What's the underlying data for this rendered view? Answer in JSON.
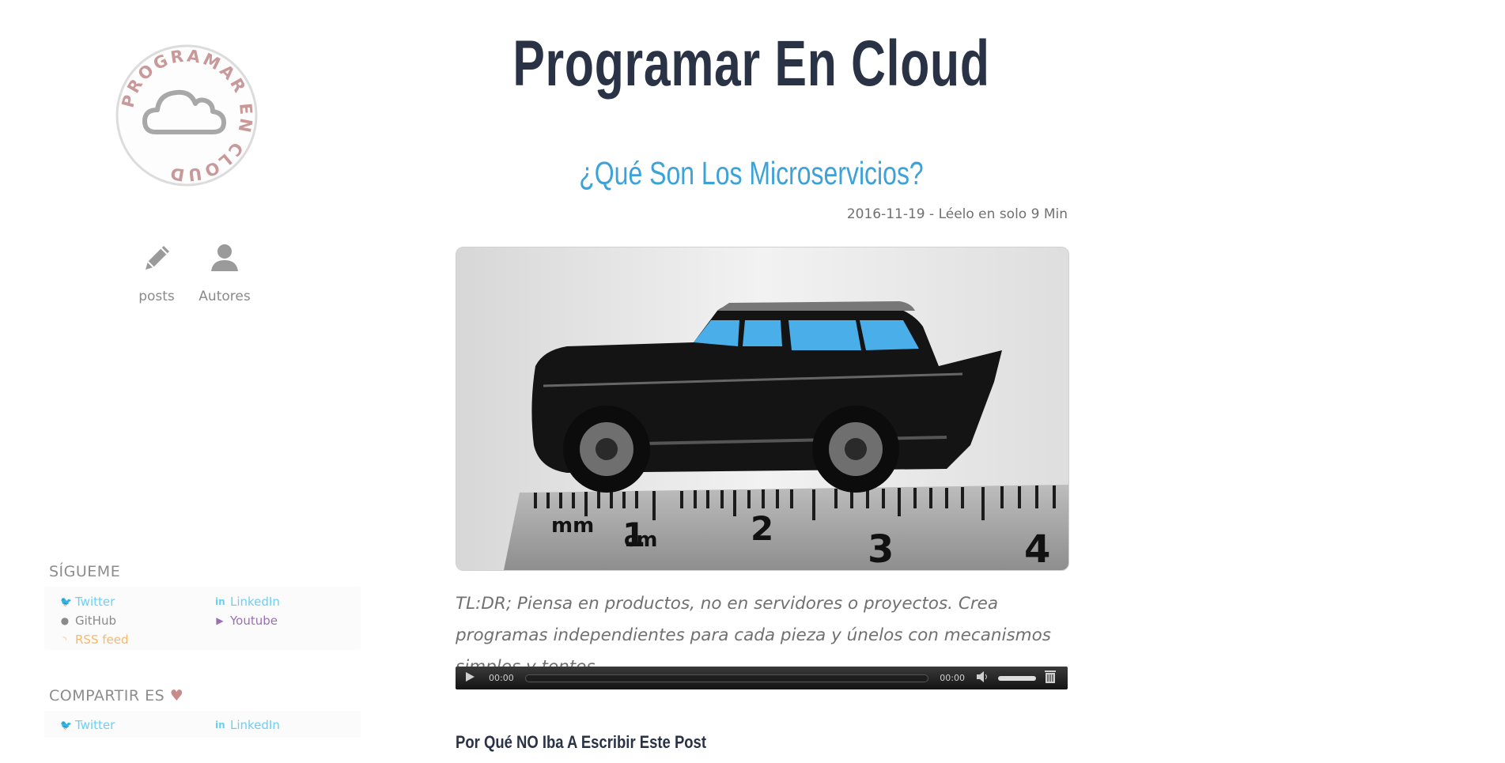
{
  "site": {
    "title": "Programar En Cloud",
    "logo_text": "PROGRAMAR EN CLOUD"
  },
  "nav": {
    "items": [
      {
        "label": "posts",
        "icon": "pencil-icon"
      },
      {
        "label": "Autores",
        "icon": "user-icon"
      }
    ]
  },
  "follow": {
    "title": "SÍGUEME",
    "links": [
      {
        "label": "Twitter",
        "icon": "twitter-icon",
        "color": "#6ccff6"
      },
      {
        "label": "LinkedIn",
        "icon": "linkedin-icon",
        "color": "#6ccff6"
      },
      {
        "label": "GitHub",
        "icon": "github-icon",
        "color": "#8a8a8a"
      },
      {
        "label": "Youtube",
        "icon": "youtube-icon",
        "color": "#9b6fb3"
      },
      {
        "label": "RSS feed",
        "icon": "rss-icon",
        "color": "#f5b86d"
      }
    ]
  },
  "share": {
    "title": "COMPARTIR ES",
    "links": [
      {
        "label": "Twitter",
        "icon": "twitter-icon"
      },
      {
        "label": "LinkedIn",
        "icon": "linkedin-icon"
      }
    ]
  },
  "post": {
    "title": "¿Qué Son Los Microservicios?",
    "meta": "2016-11-19 - Léelo en solo 9 Min",
    "hero_ruler": {
      "mm": "mm",
      "cm": "cm",
      "ticks": [
        "1",
        "2",
        "3",
        "4"
      ]
    },
    "tldr": "TL:DR; Piensa en productos, no en servidores o proyectos. Crea programas independientes para cada pieza y únelos con mecanismos simples y tontos.",
    "section_heading": "Por Qué NO Iba A Escribir Este Post"
  },
  "player": {
    "current_time": "00:00",
    "duration": "00:00"
  },
  "colors": {
    "title": "#2a3346",
    "post_title": "#3da2d8",
    "heart": "#c98a8a"
  }
}
